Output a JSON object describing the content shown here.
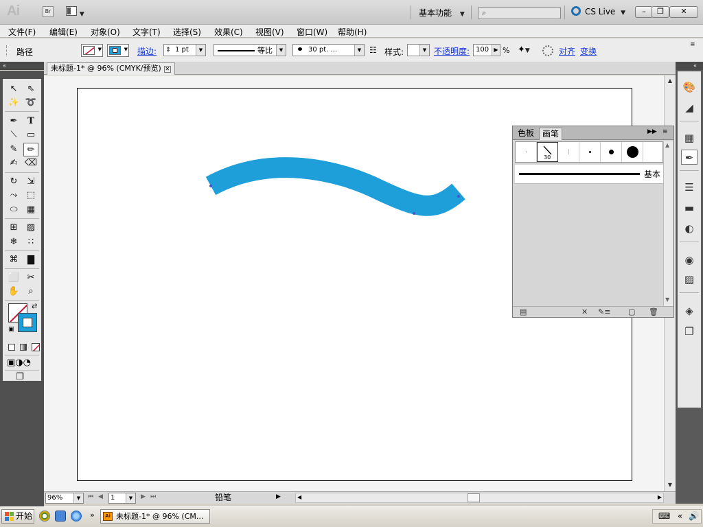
{
  "app": {
    "logo": "Ai",
    "bridge_label": "Br",
    "workspace": "基本功能",
    "search_placeholder": "",
    "cs_live": "CS Live"
  },
  "menu": [
    "文件(F)",
    "编辑(E)",
    "对象(O)",
    "文字(T)",
    "选择(S)",
    "效果(C)",
    "视图(V)",
    "窗口(W)",
    "帮助(H)"
  ],
  "control_panel": {
    "selection_label": "路径",
    "stroke_link": "描边:",
    "stroke_weight": "1 pt",
    "stroke_profile": "等比",
    "brush_def": "30 pt. ...",
    "style_label": "样式:",
    "opacity_link": "不透明度:",
    "opacity_value": "100",
    "opacity_unit": "%",
    "align_link": "对齐",
    "transform_link": "变换"
  },
  "document": {
    "tab_title": "未标题-1* @ 96% (CMYK/预览)",
    "zoom": "96%",
    "page": "1",
    "status_tool": "铅笔"
  },
  "brush_panel": {
    "tabs": [
      "色板",
      "画笔"
    ],
    "active_tab": "画笔",
    "selected_brush_size": "30",
    "list_item": "基本"
  },
  "taskbar": {
    "start_label": "开始",
    "active_window": "未标题-1* @ 96% (CM..."
  },
  "colors": {
    "stroke_path": "#1e9fda",
    "anchor": "#4455cc",
    "accent_link": "#1a3bd6",
    "dock_bg": "#5a5a5a"
  }
}
